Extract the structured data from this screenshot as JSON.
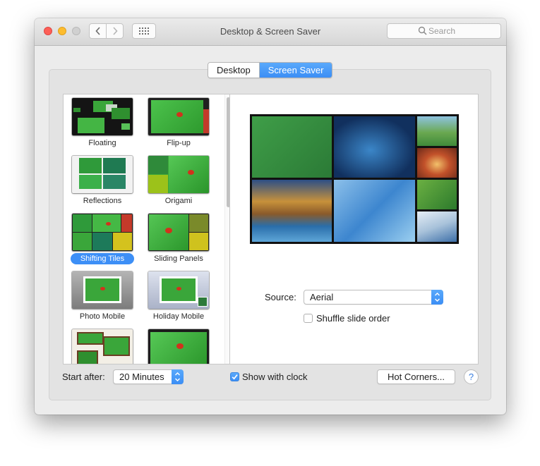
{
  "window": {
    "title": "Desktop & Screen Saver",
    "search_placeholder": "Search"
  },
  "toolbar": {
    "back_icon": "chevron-left-icon",
    "forward_icon": "chevron-right-icon",
    "grid_icon": "show-all-grid-icon"
  },
  "tabs": [
    {
      "label": "Desktop",
      "selected": false
    },
    {
      "label": "Screen Saver",
      "selected": true
    }
  ],
  "screensavers": [
    {
      "label": "Floating"
    },
    {
      "label": "Flip-up"
    },
    {
      "label": "Reflections"
    },
    {
      "label": "Origami"
    },
    {
      "label": "Shifting Tiles",
      "selected": true
    },
    {
      "label": "Sliding Panels"
    },
    {
      "label": "Photo Mobile"
    },
    {
      "label": "Holiday Mobile"
    }
  ],
  "options": {
    "source_label": "Source:",
    "source_value": "Aerial",
    "shuffle_label": "Shuffle slide order",
    "shuffle_checked": false
  },
  "bottom": {
    "start_after_label": "Start after:",
    "start_after_value": "20 Minutes",
    "show_clock_label": "Show with clock",
    "show_clock_checked": true,
    "hot_corners_label": "Hot Corners...",
    "help_label": "?"
  },
  "colors": {
    "accent": "#3d8ff6",
    "thumb_green": "#3aa63a",
    "close": "#fd5f57",
    "minimize": "#fdbc2e"
  }
}
